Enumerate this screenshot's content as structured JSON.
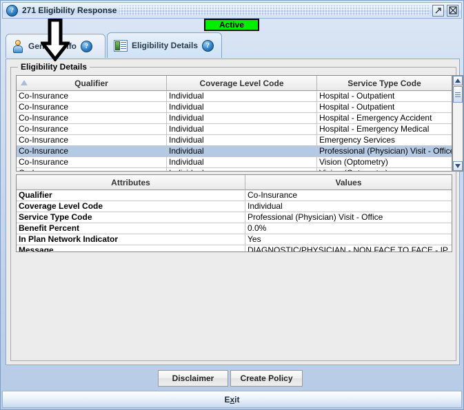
{
  "window": {
    "title": "271 Eligibility Response",
    "icon": "help-circle-icon",
    "buttons": {
      "maximize": "maximize-icon",
      "close": "close-icon"
    }
  },
  "status_badge": {
    "label": "Active",
    "color": "#00ee00",
    "border": "#000000"
  },
  "tabs": [
    {
      "label": "General Info",
      "icon": "person-icon",
      "help": "?",
      "active": false
    },
    {
      "label": "Eligibility Details",
      "icon": "id-card-icon",
      "help": "?",
      "active": true
    }
  ],
  "group": {
    "title": "Eligibility Details"
  },
  "grid_top": {
    "columns": [
      "Qualifier",
      "Coverage Level Code",
      "Service Type Code"
    ],
    "sort_column": 0,
    "sort_icon": "sort-ascending-icon",
    "selected_row_index": 5,
    "rows": [
      [
        "Co-Insurance",
        "Individual",
        "Hospital - Outpatient"
      ],
      [
        "Co-Insurance",
        "Individual",
        "Hospital - Outpatient"
      ],
      [
        "Co-Insurance",
        "Individual",
        "Hospital - Emergency Accident"
      ],
      [
        "Co-Insurance",
        "Individual",
        "Hospital - Emergency Medical"
      ],
      [
        "Co-Insurance",
        "Individual",
        "Emergency Services"
      ],
      [
        "Co-Insurance",
        "Individual",
        "Professional (Physician) Visit - Office"
      ],
      [
        "Co-Insurance",
        "Individual",
        "Vision (Optometry)"
      ],
      [
        "Co-Insurance",
        "Individual",
        "Vision (Optometry)"
      ]
    ]
  },
  "scrollbar": {
    "up": "scroll-up-arrow-icon",
    "down": "scroll-down-arrow-icon",
    "thumb": "scroll-thumb"
  },
  "grid_bottom": {
    "columns": [
      "Attributes",
      "Values"
    ],
    "rows": [
      [
        "Qualifier",
        "Co-Insurance"
      ],
      [
        "Coverage Level Code",
        "Individual"
      ],
      [
        "Service Type Code",
        "Professional (Physician) Visit - Office"
      ],
      [
        "Benefit Percent",
        "0.0%"
      ],
      [
        "In Plan Network Indicator",
        "Yes"
      ],
      [
        "Message",
        "DIAGNOSTIC/PHYSICIAN - NON FACE TO FACE - IP"
      ]
    ]
  },
  "buttons": {
    "disclaimer": "Disclaimer",
    "create_policy": "Create Policy"
  },
  "exit_bar": {
    "prefix": "E",
    "mnemonic": "x",
    "suffix": "it",
    "label": "Exit"
  },
  "overlay": {
    "arrow": "down-arrow-annotation"
  }
}
